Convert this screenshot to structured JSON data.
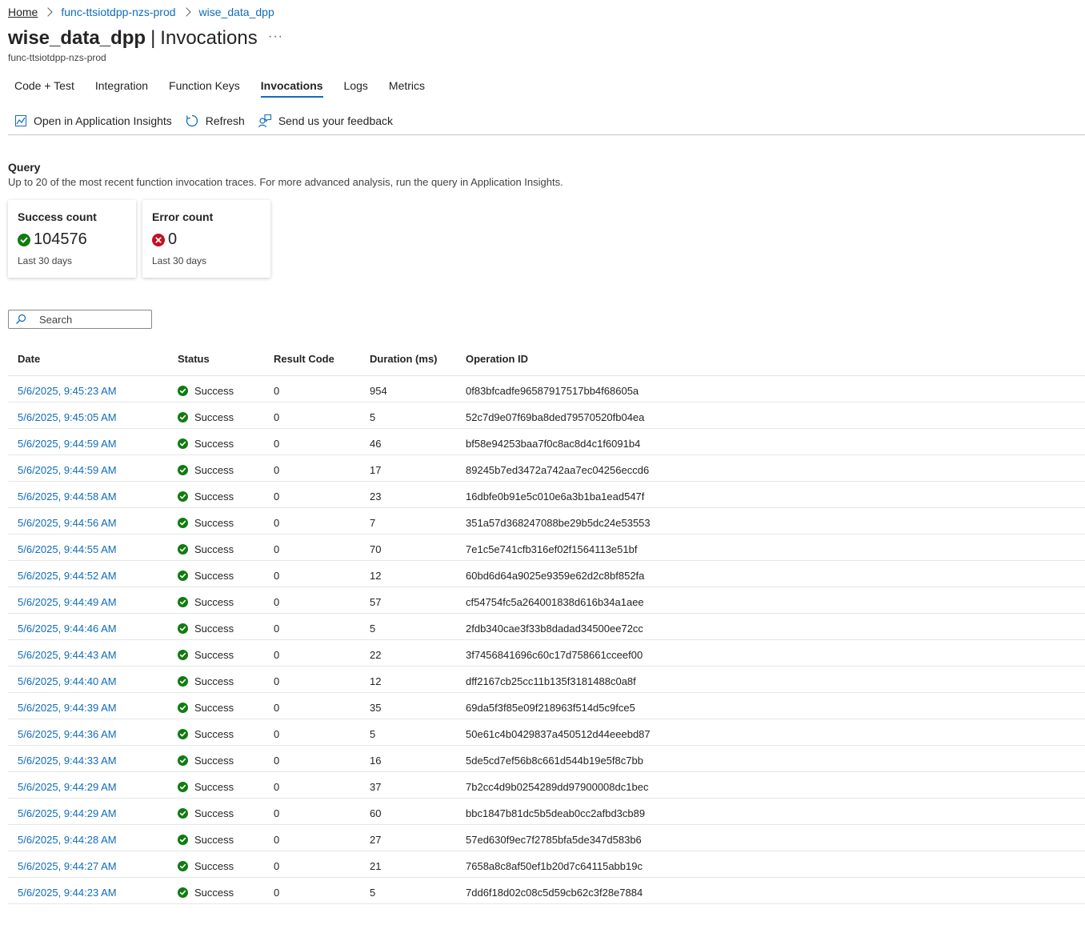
{
  "breadcrumb": [
    "Home",
    "func-ttsiotdpp-nzs-prod",
    "wise_data_dpp"
  ],
  "title": {
    "name": "wise_data_dpp",
    "separator": "|",
    "section": "Invocations",
    "more": "···"
  },
  "subtitle": "func-ttsiotdpp-nzs-prod",
  "tabs": [
    {
      "label": "Code + Test",
      "active": false
    },
    {
      "label": "Integration",
      "active": false
    },
    {
      "label": "Function Keys",
      "active": false
    },
    {
      "label": "Invocations",
      "active": true
    },
    {
      "label": "Logs",
      "active": false
    },
    {
      "label": "Metrics",
      "active": false
    }
  ],
  "toolbar": {
    "open_insights": "Open in Application Insights",
    "refresh": "Refresh",
    "feedback": "Send us your feedback"
  },
  "query": {
    "title": "Query",
    "description": "Up to 20 of the most recent function invocation traces. For more advanced analysis, run the query in Application Insights."
  },
  "cards": {
    "success": {
      "label": "Success count",
      "value": "104576",
      "sub": "Last 30 days",
      "color": "#107c10"
    },
    "error": {
      "label": "Error count",
      "value": "0",
      "sub": "Last 30 days",
      "color": "#c50f1f"
    }
  },
  "search": {
    "placeholder": "Search"
  },
  "table": {
    "headers": [
      "Date",
      "Status",
      "Result Code",
      "Duration (ms)",
      "Operation ID"
    ],
    "rows": [
      [
        "5/6/2025, 9:45:23 AM",
        "Success",
        "0",
        "954",
        "0f83bfcadfe96587917517bb4f68605a"
      ],
      [
        "5/6/2025, 9:45:05 AM",
        "Success",
        "0",
        "5",
        "52c7d9e07f69ba8ded79570520fb04ea"
      ],
      [
        "5/6/2025, 9:44:59 AM",
        "Success",
        "0",
        "46",
        "bf58e94253baa7f0c8ac8d4c1f6091b4"
      ],
      [
        "5/6/2025, 9:44:59 AM",
        "Success",
        "0",
        "17",
        "89245b7ed3472a742aa7ec04256eccd6"
      ],
      [
        "5/6/2025, 9:44:58 AM",
        "Success",
        "0",
        "23",
        "16dbfe0b91e5c010e6a3b1ba1ead547f"
      ],
      [
        "5/6/2025, 9:44:56 AM",
        "Success",
        "0",
        "7",
        "351a57d368247088be29b5dc24e53553"
      ],
      [
        "5/6/2025, 9:44:55 AM",
        "Success",
        "0",
        "70",
        "7e1c5e741cfb316ef02f1564113e51bf"
      ],
      [
        "5/6/2025, 9:44:52 AM",
        "Success",
        "0",
        "12",
        "60bd6d64a9025e9359e62d2c8bf852fa"
      ],
      [
        "5/6/2025, 9:44:49 AM",
        "Success",
        "0",
        "57",
        "cf54754fc5a264001838d616b34a1aee"
      ],
      [
        "5/6/2025, 9:44:46 AM",
        "Success",
        "0",
        "5",
        "2fdb340cae3f33b8dadad34500ee72cc"
      ],
      [
        "5/6/2025, 9:44:43 AM",
        "Success",
        "0",
        "22",
        "3f7456841696c60c17d758661cceef00"
      ],
      [
        "5/6/2025, 9:44:40 AM",
        "Success",
        "0",
        "12",
        "dff2167cb25cc11b135f3181488c0a8f"
      ],
      [
        "5/6/2025, 9:44:39 AM",
        "Success",
        "0",
        "35",
        "69da5f3f85e09f218963f514d5c9fce5"
      ],
      [
        "5/6/2025, 9:44:36 AM",
        "Success",
        "0",
        "5",
        "50e61c4b0429837a450512d44eeebd87"
      ],
      [
        "5/6/2025, 9:44:33 AM",
        "Success",
        "0",
        "16",
        "5de5cd7ef56b8c661d544b19e5f8c7bb"
      ],
      [
        "5/6/2025, 9:44:29 AM",
        "Success",
        "0",
        "37",
        "7b2cc4d9b0254289dd97900008dc1bec"
      ],
      [
        "5/6/2025, 9:44:29 AM",
        "Success",
        "0",
        "60",
        "bbc1847b81dc5b5deab0cc2afbd3cb89"
      ],
      [
        "5/6/2025, 9:44:28 AM",
        "Success",
        "0",
        "27",
        "57ed630f9ec7f2785bfa5de347d583b6"
      ],
      [
        "5/6/2025, 9:44:27 AM",
        "Success",
        "0",
        "21",
        "7658a8c8af50ef1b20d7c64115abb19c"
      ],
      [
        "5/6/2025, 9:44:23 AM",
        "Success",
        "0",
        "5",
        "7dd6f18d02c08c5d59cb62c3f28e7884"
      ]
    ]
  }
}
